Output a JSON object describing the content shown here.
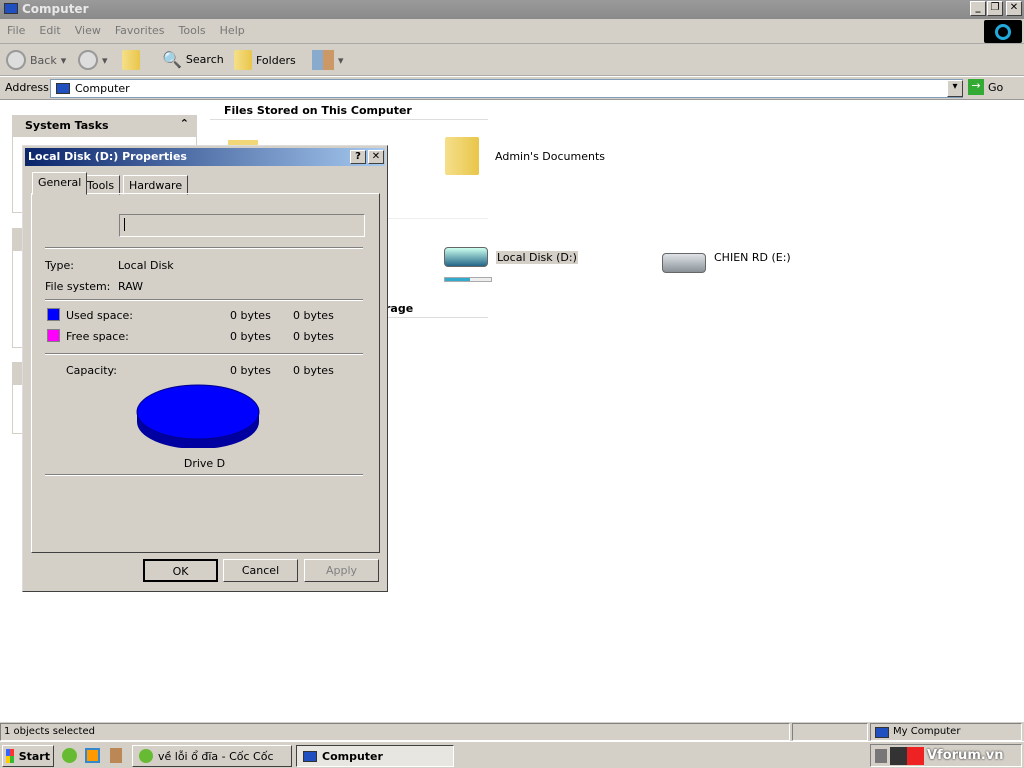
{
  "window": {
    "title": "Computer"
  },
  "menu": [
    "File",
    "Edit",
    "View",
    "Favorites",
    "Tools",
    "Help"
  ],
  "toolbar": {
    "back": "Back",
    "search": "Search",
    "folders": "Folders"
  },
  "address": {
    "label": "Address",
    "value": "Computer",
    "go": "Go"
  },
  "sidebar": {
    "system_tasks": "System Tasks"
  },
  "content": {
    "section_files": "Files Stored on This Computer",
    "section_storage_fragment": "rage",
    "items": [
      {
        "label": "Admin's Documents",
        "icon": "folder-icon"
      },
      {
        "label": "Local Disk (D:)",
        "icon": "hard-drive-icon",
        "usage_percent": 55,
        "selected": true
      },
      {
        "label": "CHIEN RD (E:)",
        "icon": "hard-drive-icon"
      }
    ]
  },
  "dialog": {
    "title": "Local Disk (D:) Properties",
    "help": "?",
    "close": "✕",
    "tabs": [
      "General",
      "Tools",
      "Hardware"
    ],
    "label_value": "",
    "type_label": "Type:",
    "type_value": "Local Disk",
    "fs_label": "File system:",
    "fs_value": "RAW",
    "used_label": "Used space:",
    "used_bytes": "0 bytes",
    "used_size": "0 bytes",
    "free_label": "Free space:",
    "free_bytes": "0 bytes",
    "free_size": "0 bytes",
    "cap_label": "Capacity:",
    "cap_bytes": "0 bytes",
    "cap_size": "0 bytes",
    "drive_label": "Drive D",
    "ok": "OK",
    "cancel": "Cancel",
    "apply": "Apply",
    "colors": {
      "used": "#0000ff",
      "free": "#ff00ff"
    }
  },
  "status": {
    "left": "1 objects selected",
    "right": "My Computer"
  },
  "taskbar": {
    "start": "Start",
    "tasks": [
      "về lỗi ổ đĩa - Cốc Cốc",
      "Computer"
    ],
    "tray_brand": "Vforum.vn"
  }
}
